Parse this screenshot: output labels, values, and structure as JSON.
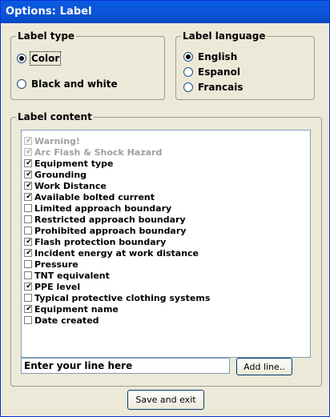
{
  "window": {
    "title": "Options: Label"
  },
  "label_type": {
    "title": "Label type",
    "options": [
      {
        "label": "Color",
        "selected": true
      },
      {
        "label": "Black and white",
        "selected": false
      }
    ]
  },
  "label_language": {
    "title": "Label language",
    "options": [
      {
        "label": "English",
        "selected": true
      },
      {
        "label": "Espanol",
        "selected": false
      },
      {
        "label": "Francais",
        "selected": false
      }
    ]
  },
  "label_content": {
    "title": "Label content",
    "items": [
      {
        "label": "Warning!",
        "checked": true,
        "disabled": true
      },
      {
        "label": "Arc Flash & Shock Hazard",
        "checked": true,
        "disabled": true
      },
      {
        "label": "Equipment type",
        "checked": true,
        "disabled": false
      },
      {
        "label": "Grounding",
        "checked": true,
        "disabled": false
      },
      {
        "label": "Work Distance",
        "checked": true,
        "disabled": false
      },
      {
        "label": "Available bolted current",
        "checked": true,
        "disabled": false
      },
      {
        "label": "Limited approach boundary",
        "checked": false,
        "disabled": false
      },
      {
        "label": "Restricted approach boundary",
        "checked": false,
        "disabled": false
      },
      {
        "label": "Prohibited approach boundary",
        "checked": false,
        "disabled": false
      },
      {
        "label": "Flash protection boundary",
        "checked": true,
        "disabled": false
      },
      {
        "label": "Incident energy at work distance",
        "checked": true,
        "disabled": false
      },
      {
        "label": "Pressure",
        "checked": false,
        "disabled": false
      },
      {
        "label": "TNT equivalent",
        "checked": false,
        "disabled": false
      },
      {
        "label": "PPE level",
        "checked": true,
        "disabled": false
      },
      {
        "label": "Typical protective clothing systems",
        "checked": false,
        "disabled": false
      },
      {
        "label": "Equipment name",
        "checked": true,
        "disabled": false
      },
      {
        "label": "Date created",
        "checked": false,
        "disabled": false
      }
    ],
    "line_input_value": "Enter your line here",
    "add_line_label": "Add line.."
  },
  "footer": {
    "save_label": "Save and exit"
  }
}
